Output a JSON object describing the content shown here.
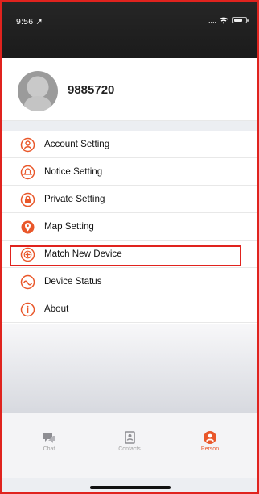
{
  "status_bar": {
    "time": "9:56",
    "location_arrow": "➚",
    "signal": "....",
    "wifi": "wifi-icon"
  },
  "profile": {
    "username": "9885720"
  },
  "menu": {
    "items": [
      {
        "label": "Account Setting",
        "icon": "account-setting-icon"
      },
      {
        "label": "Notice Setting",
        "icon": "notice-setting-icon"
      },
      {
        "label": "Private Setting",
        "icon": "private-setting-icon"
      },
      {
        "label": "Map Setting",
        "icon": "map-setting-icon"
      },
      {
        "label": "Match New Device",
        "icon": "match-new-device-icon"
      },
      {
        "label": "Device Status",
        "icon": "device-status-icon"
      },
      {
        "label": "About",
        "icon": "about-icon"
      }
    ]
  },
  "tabs": [
    {
      "label": "Chat",
      "icon": "chat-icon",
      "active": false
    },
    {
      "label": "Contacts",
      "icon": "contacts-icon",
      "active": false
    },
    {
      "label": "Person",
      "icon": "person-icon",
      "active": true
    }
  ],
  "colors": {
    "accent": "#e9572a",
    "highlight_border": "#e0231e",
    "status_bar": "#222222",
    "menu_text": "#111111"
  }
}
